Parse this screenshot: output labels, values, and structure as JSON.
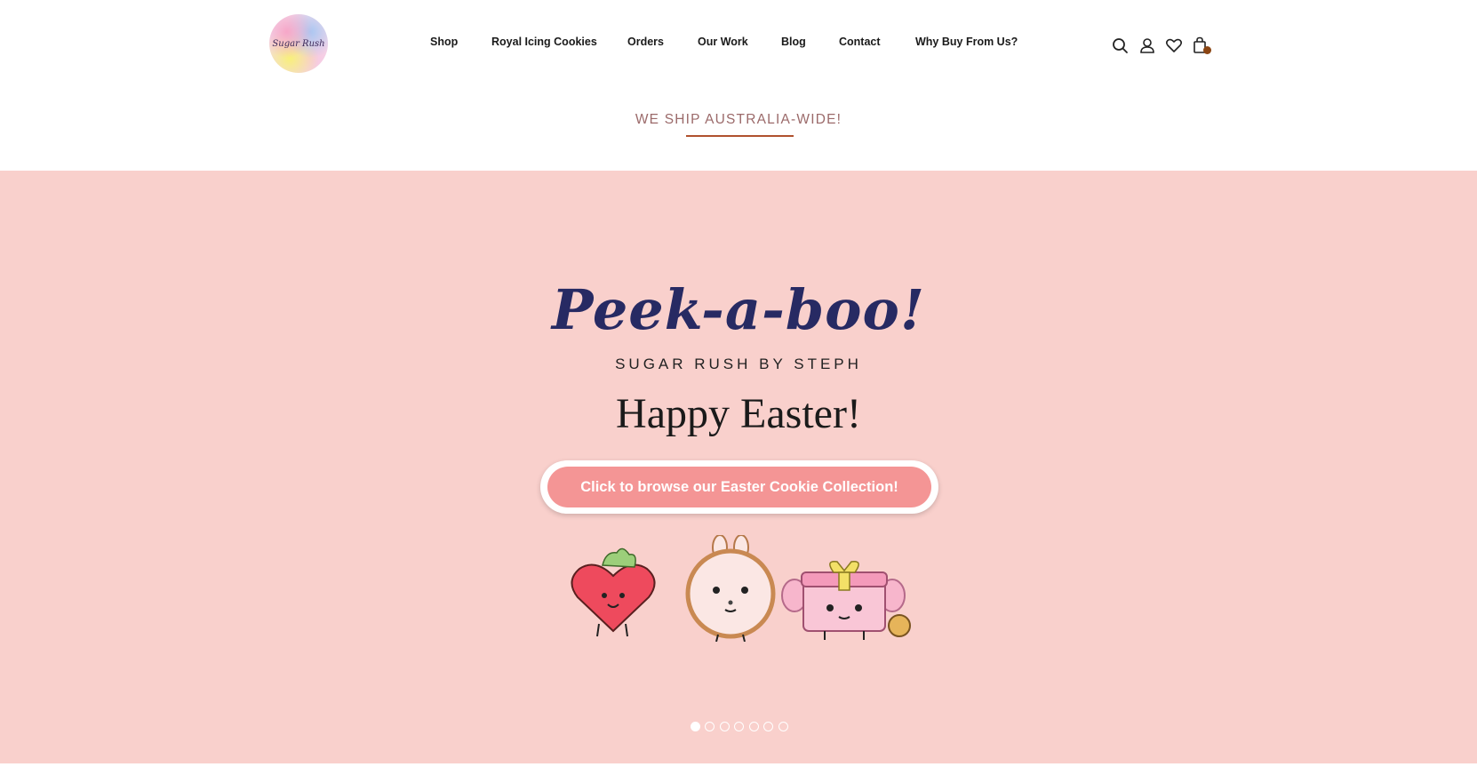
{
  "header": {
    "logo_text": "Sugar Rush",
    "nav": [
      {
        "label": "Shop"
      },
      {
        "label": "Royal Icing Cookies"
      },
      {
        "label": "Orders"
      },
      {
        "label": "Our Work"
      },
      {
        "label": "Blog"
      },
      {
        "label": "Contact"
      },
      {
        "label": "Why Buy From Us?"
      }
    ],
    "icons": [
      "search-icon",
      "account-icon",
      "wishlist-icon",
      "cart-icon"
    ]
  },
  "announcement": {
    "text": "WE SHIP AUSTRALIA-WIDE!",
    "underline_color": "#b0522e"
  },
  "hero": {
    "background": "#f9d0cc",
    "script_title": "Peek-a-boo!",
    "subtitle": "SUGAR RUSH BY STEPH",
    "title": "Happy Easter!",
    "button_label": "Click to browse our Easter Cookie Collection!",
    "button_color": "#f49595",
    "slides_total": 7,
    "active_slide": 1
  }
}
